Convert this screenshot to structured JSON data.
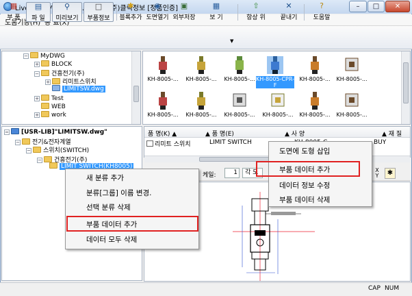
{
  "window": {
    "title": "LiveClick Ver.2.3.12.2578 - (주)클릭정보 [정품인증]",
    "minimize": "–",
    "maximize": "□",
    "close": "✕"
  },
  "menu": [
    "도움기능(H)",
    "종 료(X)"
  ],
  "toolbar": {
    "items": [
      {
        "label": "부 품",
        "icon": "parts-icon"
      },
      {
        "label": "파 일",
        "icon": "file-icon"
      },
      {
        "label": "미리보기",
        "icon": "preview-icon"
      },
      {
        "label": "부품정보",
        "icon": "part-info-icon"
      },
      {
        "label": "블록추가",
        "icon": "block-add-icon"
      },
      {
        "label": "도면열기",
        "icon": "drawing-open-icon"
      },
      {
        "label": "외부저장",
        "icon": "external-save-icon"
      },
      {
        "label": "보 기",
        "icon": "view-icon"
      },
      {
        "label": "항상 위",
        "icon": "always-on-top-icon"
      },
      {
        "label": "끝내기",
        "icon": "exit-icon"
      },
      {
        "label": "도움말",
        "icon": "help-icon"
      }
    ]
  },
  "file_tree": {
    "items": [
      "MyDWG",
      "BLOCK",
      "건흥전기(주)",
      "리미트스위치",
      "LIMITSW.dwg",
      "Test",
      "WEB",
      "work"
    ]
  },
  "thumbnails": {
    "row1": [
      "KH-8005-...",
      "KH-8005-...",
      "KH-8005-...",
      "KH-8005-CPR-F",
      "KH-8005-...",
      "KH-8005-..."
    ],
    "row2": [
      "KH-8005-...",
      "KH-8005-...",
      "KH-8005-...",
      "KH-8005-...",
      "KH-8005-...",
      "KH-8005-..."
    ]
  },
  "lib_tree": {
    "root": "[USR-LIB]\"LIMITSW.dwg\"",
    "items": [
      "전기&전자계열",
      "스위치(SWITCH)",
      "건흥전기(주)",
      "LIMIT SWITCH(KH8005)"
    ]
  },
  "grid": {
    "headers": [
      "품 명(K) ▲",
      "▲ 품 명(E)",
      "▲ 사 양",
      "▲ 재 질"
    ],
    "row": [
      "리미트 스위치",
      "LIMIT SWITCH",
      "KH-8005-C",
      "BUY"
    ]
  },
  "scale_bar": {
    "label": "케일:",
    "value": "1",
    "item": "각 도"
  },
  "context_menu_left": [
    "새 분류 추가",
    "분류[그룹] 이름 변경.",
    "선택 분류 삭제",
    "부품 데이터 추가",
    "데이터 모두 삭제"
  ],
  "context_menu_right": [
    "도면에 도형 삽입",
    "부품 데이터 추가",
    "데이터 정보 수정",
    "부품 데이터 삭제"
  ],
  "status": {
    "cap": "CAP",
    "num": "NUM"
  },
  "colors": {
    "highlight_border": "#e02020",
    "selection": "#3399ff"
  }
}
